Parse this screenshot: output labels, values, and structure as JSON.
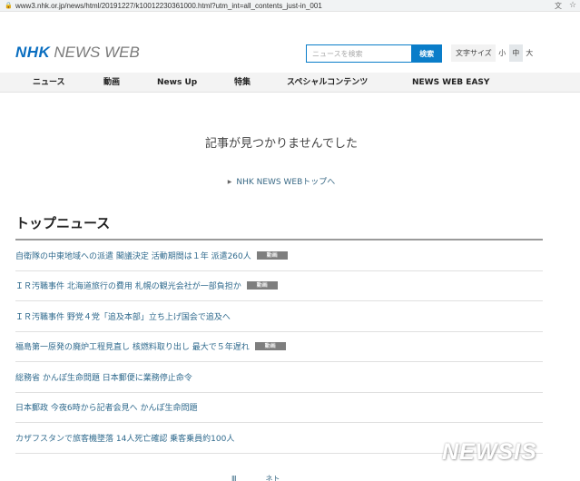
{
  "browser": {
    "url": "www3.nhk.or.jp/news/html/20191227/k10012230361000.html?utm_int=all_contents_just-in_001",
    "lock_icon": "lock-icon",
    "translate_icon": "translate-icon",
    "star_icon": "star-icon"
  },
  "header": {
    "logo_nhk": "NHK",
    "logo_newsweb": "NEWS WEB",
    "search_placeholder": "ニュースを検索",
    "search_button": "検索",
    "font_size_label": "文字サイズ",
    "font_size_options": [
      "小",
      "中",
      "大"
    ],
    "font_size_selected": "中"
  },
  "nav": {
    "items": [
      {
        "label": "ニュース"
      },
      {
        "label": "動画"
      },
      {
        "label": "News Up"
      },
      {
        "label": "特集"
      },
      {
        "label": "スペシャルコンテンツ"
      },
      {
        "label": "NEWS WEB EASY"
      }
    ]
  },
  "main": {
    "not_found_message": "記事が見つかりませんでした",
    "top_link": "NHK NEWS WEBトップへ",
    "top_link_icon": "triangle-right-icon",
    "section_title": "トップニュース",
    "news": [
      {
        "title": "自衛隊の中東地域への派遣 閣議決定 活動期間は１年 派遣260人",
        "badge": "動画"
      },
      {
        "title": "ＩＲ汚職事件 北海道旅行の費用 札幌の観光会社が一部負担か",
        "badge": "動画"
      },
      {
        "title": "ＩＲ汚職事件 野党４党「追及本部」立ち上げ国会で追及へ",
        "badge": null
      },
      {
        "title": "福島第一原発の廃炉工程見直し 核燃料取り出し 最大で５年遅れ",
        "badge": "動画"
      },
      {
        "title": "総務省 かんぽ生命問題 日本郵便に業務停止命令",
        "badge": null
      },
      {
        "title": "日本郵政 今夜6時から記者会見へ かんぽ生命問題",
        "badge": null
      },
      {
        "title": "カザフスタンで旅客機墜落 14人死亡確認 乗客乗員約100人",
        "badge": null
      }
    ],
    "partial_footer_text": "Ⅲ　　　　ネト"
  },
  "watermark": "NEWSIS",
  "colors": {
    "brand_blue": "#0a6ec0",
    "search_blue": "#0a7dc9",
    "link": "#2f6a8d",
    "badge": "#7e7e7e"
  }
}
